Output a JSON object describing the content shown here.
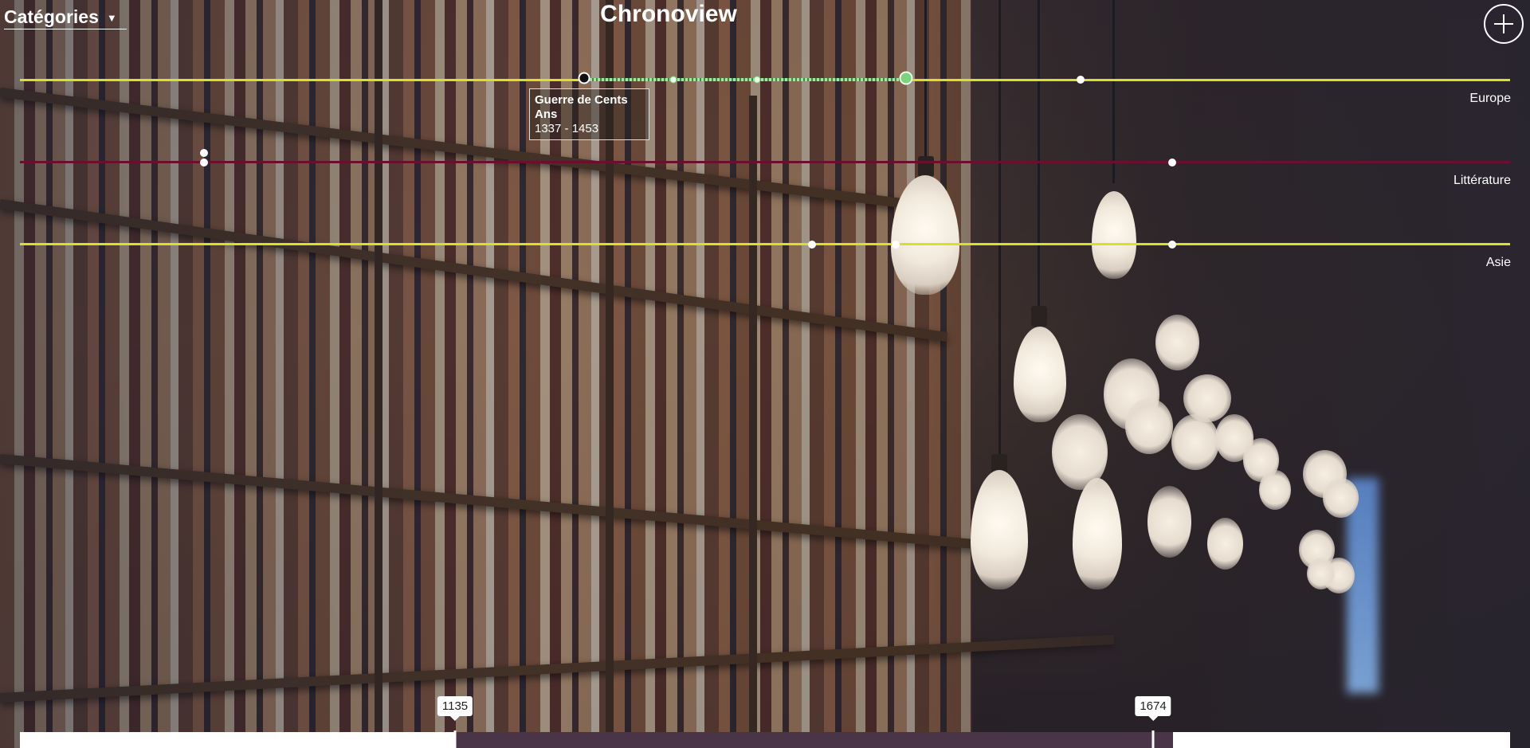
{
  "header": {
    "categories_label": "Catégories",
    "title": "Chronoview",
    "add_button_icon": "plus-circle-icon"
  },
  "range": {
    "min": 1135,
    "max": 1674,
    "start_label": "1135",
    "end_label": "1674"
  },
  "colors": {
    "europe": "#d8e02a",
    "litterature": "#6a0f2e",
    "asie": "#d8e02a",
    "range_fill": "#4a3448",
    "span_highlight": "#7cd37c"
  },
  "timelines": [
    {
      "label": "Europe"
    },
    {
      "label": "Littérature"
    },
    {
      "label": "Asie"
    }
  ],
  "tooltip": {
    "title": "Guerre de Cents Ans",
    "dates": "1337 - 1453"
  }
}
